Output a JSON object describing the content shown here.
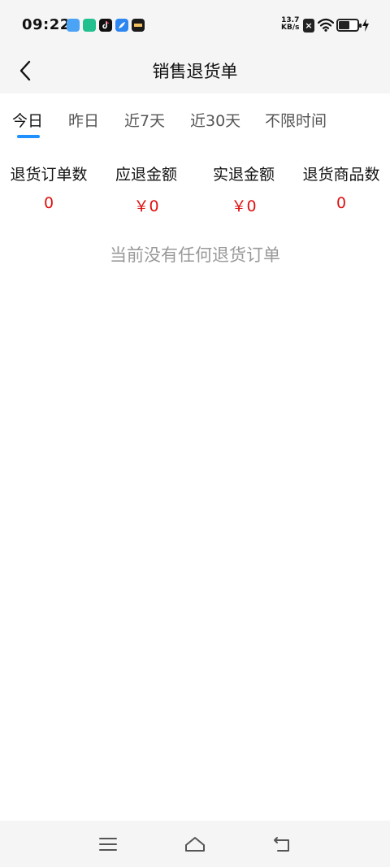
{
  "status_bar": {
    "time": "09:22",
    "net_speed_value": "13.7",
    "net_speed_unit": "KB/s",
    "apps": [
      "app-blue-icon",
      "app-green-icon",
      "tiktok-icon",
      "app-feather-icon",
      "app-dark-icon"
    ],
    "sim_label": "×"
  },
  "header": {
    "title": "销售退货单"
  },
  "tabs": [
    {
      "label": "今日",
      "active": true
    },
    {
      "label": "昨日",
      "active": false
    },
    {
      "label": "近7天",
      "active": false
    },
    {
      "label": "近30天",
      "active": false
    },
    {
      "label": "不限时间",
      "active": false
    }
  ],
  "stats": [
    {
      "label": "退货订单数",
      "value": "0"
    },
    {
      "label": "应退金额",
      "value": "￥0"
    },
    {
      "label": "实退金额",
      "value": "￥0"
    },
    {
      "label": "退货商品数",
      "value": "0"
    }
  ],
  "empty_message": "当前没有任何退货订单",
  "colors": {
    "accent": "#1e90ff",
    "value_red": "#e01010",
    "bar_bg": "#f5f5f5",
    "empty_text": "#999999"
  }
}
